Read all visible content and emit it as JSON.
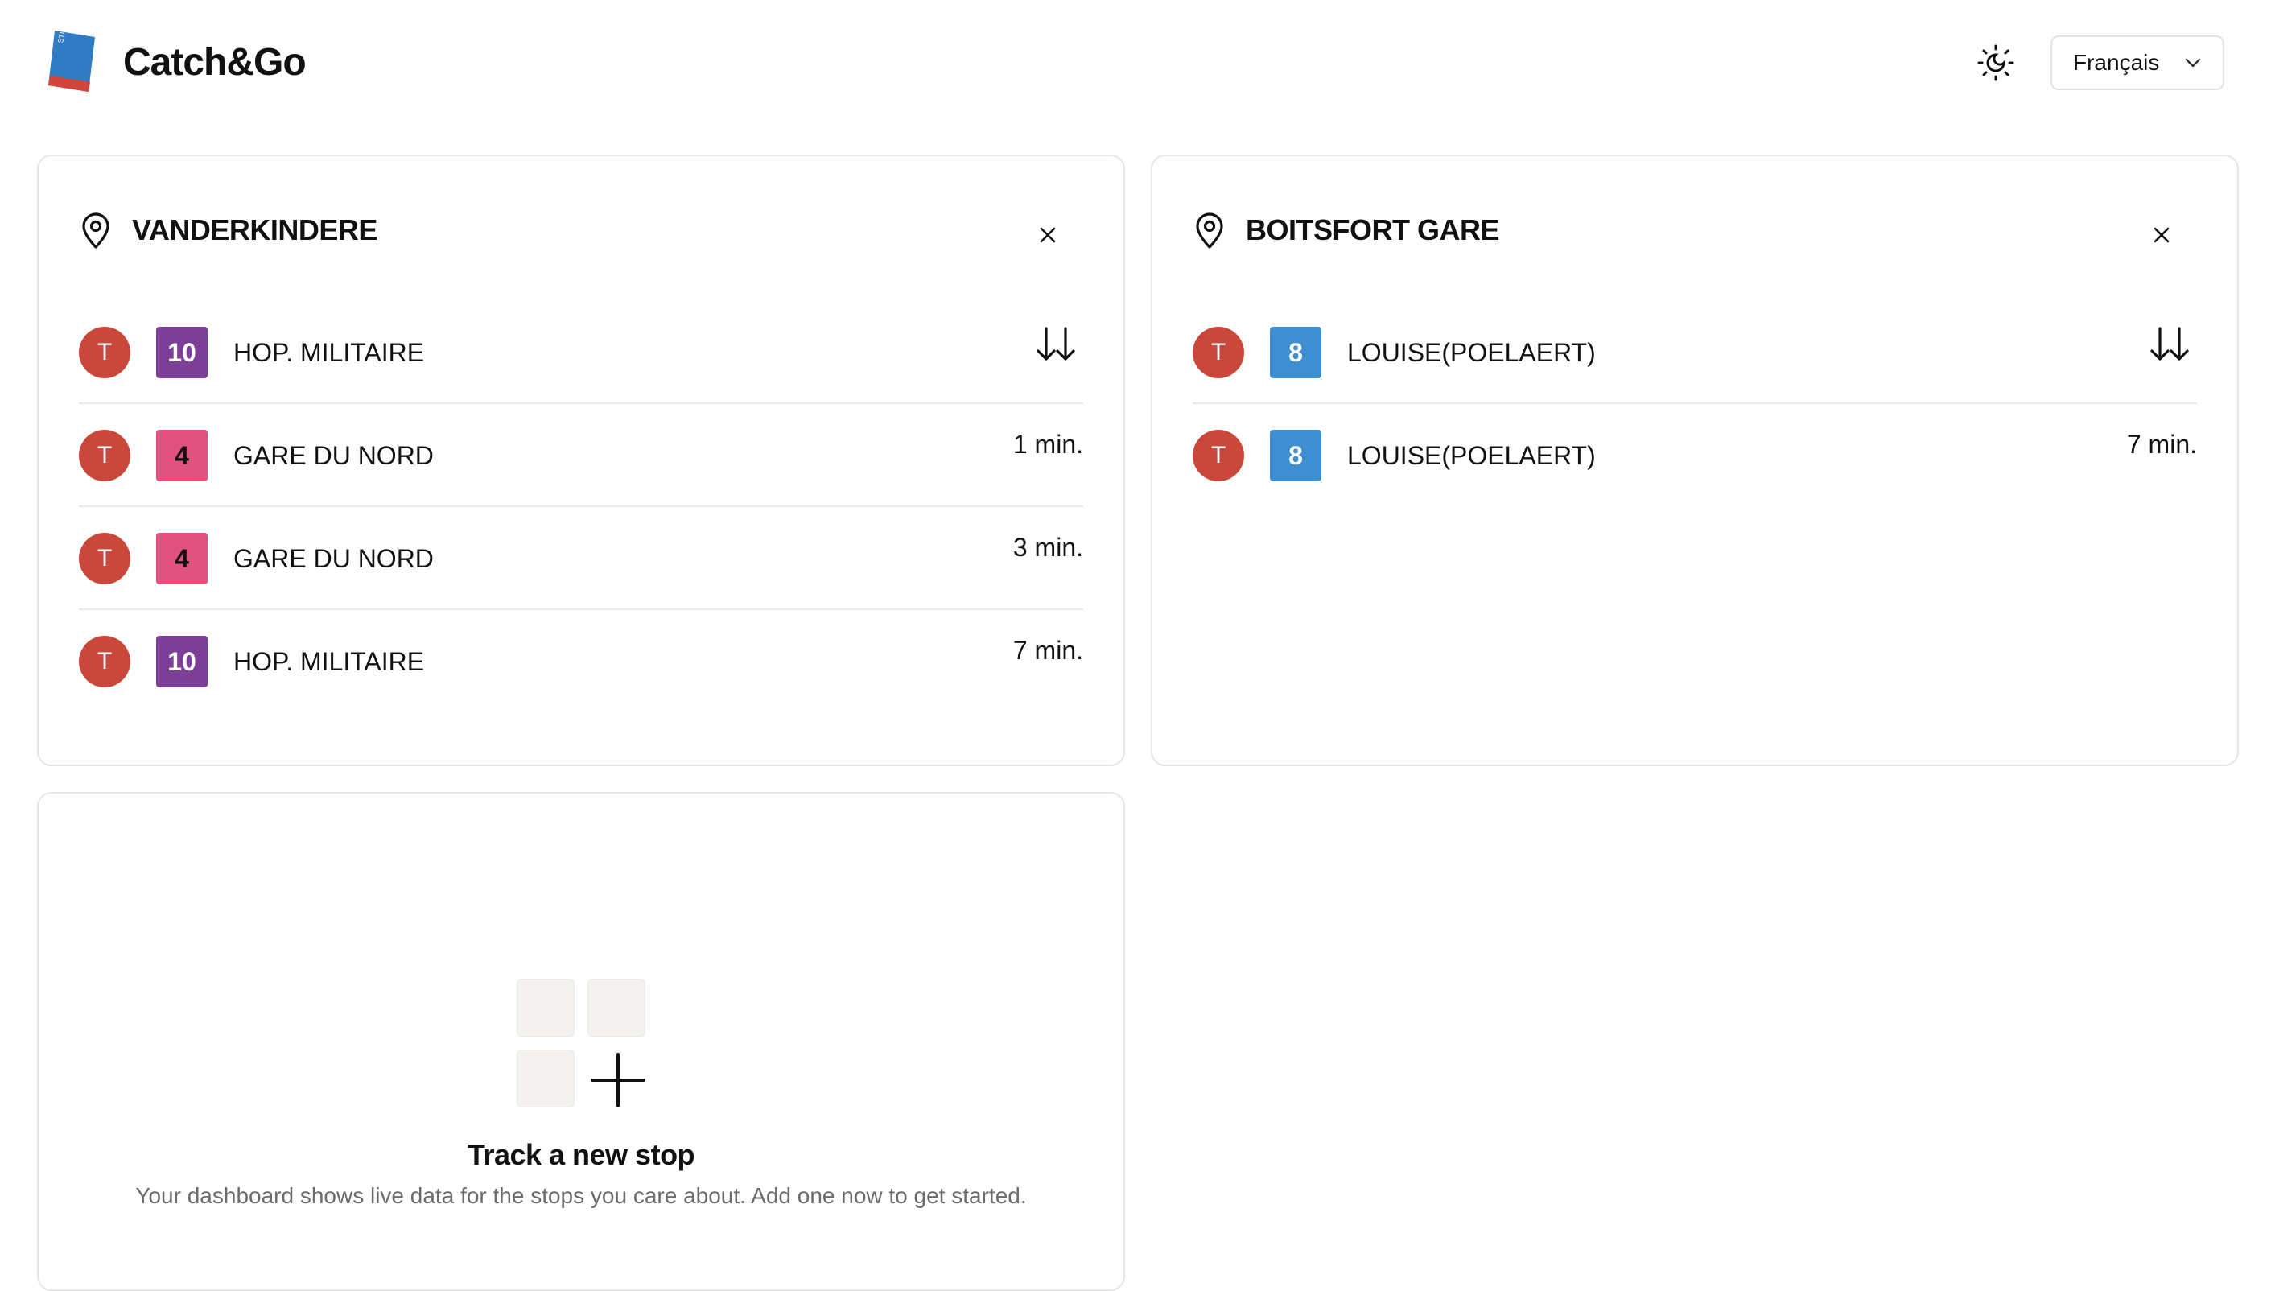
{
  "header": {
    "app_title": "Catch&Go",
    "logo_text": "STIB MIVB",
    "theme_icon": "sun-moon-icon",
    "language": {
      "selected": "Français"
    }
  },
  "stops": [
    {
      "name": "VANDERKINDERE",
      "departures": [
        {
          "mode": "T",
          "line": "10",
          "line_color": "#7b3f98",
          "destination": "HOP. MILITAIRE",
          "time": ""
        },
        {
          "mode": "T",
          "line": "4",
          "line_color": "#e0517d",
          "line_text_color": "#111111",
          "destination": "GARE DU NORD",
          "time": "1 min."
        },
        {
          "mode": "T",
          "line": "4",
          "line_color": "#e0517d",
          "line_text_color": "#111111",
          "destination": "GARE DU NORD",
          "time": "3 min."
        },
        {
          "mode": "T",
          "line": "10",
          "line_color": "#7b3f98",
          "destination": "HOP. MILITAIRE",
          "time": "7 min."
        }
      ]
    },
    {
      "name": "BOITSFORT GARE",
      "departures": [
        {
          "mode": "T",
          "line": "8",
          "line_color": "#3d8fd1",
          "destination": "LOUISE(POELAERT)",
          "time": ""
        },
        {
          "mode": "T",
          "line": "8",
          "line_color": "#3d8fd1",
          "destination": "LOUISE(POELAERT)",
          "time": "7 min."
        }
      ]
    }
  ],
  "empty_state": {
    "title": "Track a new stop",
    "description": "Your dashboard shows live data for the stops you care about. Add one now to get started."
  },
  "colors": {
    "mode_badge": "#c9473b",
    "border": "#e6e6e6",
    "muted_text": "#6b6b6b"
  }
}
